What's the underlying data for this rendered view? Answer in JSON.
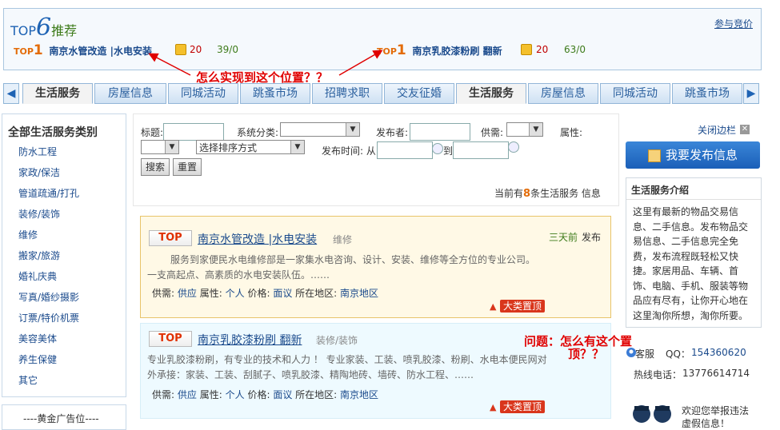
{
  "top6": {
    "prefix": "TOP",
    "number": "6",
    "label": "推荐",
    "join_link": "参与竞价",
    "items": [
      {
        "tag": "TOP",
        "rank": "1",
        "title": "南京水管改造 |水电安装",
        "coins": "20",
        "stat": "39/0"
      },
      {
        "tag": "TOP",
        "rank": "1",
        "title": "南京乳胶漆粉刷 翻新",
        "coins": "20",
        "stat": "63/0"
      }
    ]
  },
  "annotations": {
    "first": "怎么实现到这个位置？？",
    "second_line1": "问题：怎么有这个置",
    "second_line2": "顶？？"
  },
  "tabs": [
    "生活服务",
    "房屋信息",
    "同城活动",
    "跳蚤市场",
    "招聘求职",
    "交友征婚",
    "生活服务",
    "房屋信息",
    "同城活动",
    "跳蚤市场"
  ],
  "sidebar": {
    "heading": "全部生活服务类别",
    "items": [
      "防水工程",
      "家政/保洁",
      "管道疏通/打孔",
      "装修/装饰",
      "维修",
      "搬家/旅游",
      "婚礼庆典",
      "写真/婚纱摄影",
      "订票/特价机票",
      "美容美体",
      "养生保健",
      "其它"
    ],
    "ad_label": "----黄金广告位----"
  },
  "search": {
    "title_label": "标题:",
    "category_label": "系统分类:",
    "publisher_label": "发布者:",
    "supply_label": "供需:",
    "attr_label": "属性:",
    "sort_default": "选择排序方式",
    "time_label": "发布时间: 从",
    "to_label": "到",
    "search_button": "搜索",
    "reset_button": "重置",
    "count_prefix": "当前有",
    "count": "8",
    "count_suffix": "条生活服务 信息"
  },
  "listings": [
    {
      "badge": "TOP",
      "title": "南京水管改造 |水电安装",
      "category": "维修",
      "time": "三天前",
      "time_suffix": "发布",
      "desc1": "服务到家便民水电维修部是一家集水电咨询、设计、安装、维修等全方位的专业公司。",
      "desc2": "一支高起点、高素质的水电安装队伍。……",
      "supply_label": "供需:",
      "supply": "供应",
      "attr_label": "属性:",
      "attr": "个人",
      "price_label": "价格:",
      "price": "面议",
      "area_label": "所在地区:",
      "area": "南京地区",
      "pin": "大类置顶"
    },
    {
      "badge": "TOP",
      "title": "南京乳胶漆粉刷 翻新",
      "category": "装修/装饰",
      "desc1": "专业乳胶漆粉刷，有专业的技术和人力 ！ 专业家装、工装、喷乳胶漆、粉刷、水电本便民网对",
      "desc2": "外承接：家装、工装、刮腻子、喷乳胶漆、精陶地砖、墙砖、防水工程、……",
      "supply_label": "供需:",
      "supply": "供应",
      "attr_label": "属性:",
      "attr": "个人",
      "price_label": "价格:",
      "price": "面议",
      "area_label": "所在地区:",
      "area": "南京地区",
      "pin": "大类置顶"
    }
  ],
  "right": {
    "close_sidebar": "关闭边栏",
    "publish_button": "我要发布信息",
    "intro_heading": "生活服务介绍",
    "intro_text": "这里有最新的物品交易信息、二手信息。发布物品交易信息、二手信息完全免费，发布流程既轻松又快捷。家居用品、车辆、首饰、电脑、手机、服装等物品应有尽有，让你开心地在这里淘你所想，淘你所要。",
    "kefu": "客服",
    "qq_label": "QQ：",
    "qq": "154360620",
    "hotline_label": "热线电话：",
    "hotline": "13776614714",
    "report_line1": "欢迎您举报违法",
    "report_line2": "虚假信息！"
  },
  "colors": {
    "link": "#1a4a8c",
    "accent_blue": "#1e63b4",
    "annotation_red": "#e00000",
    "pin_red": "#d9361c"
  }
}
